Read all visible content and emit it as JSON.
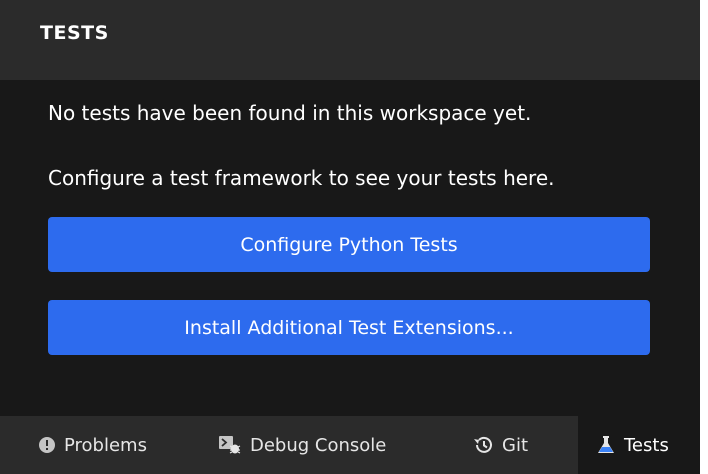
{
  "panel": {
    "title": "TESTS",
    "message_1": "No tests have been found in this workspace yet.",
    "message_2": "Configure a test framework to see your tests here.",
    "configure_button": "Configure Python Tests",
    "install_button": "Install Additional Test Extensions..."
  },
  "tabs": [
    {
      "label": "Problems",
      "icon": "info-circle-icon",
      "active": false
    },
    {
      "label": "Debug Console",
      "icon": "debug-console-icon",
      "active": false
    },
    {
      "label": "Git",
      "icon": "history-icon",
      "active": false
    },
    {
      "label": "Tests",
      "icon": "flask-icon",
      "active": true
    }
  ],
  "colors": {
    "background": "#181818",
    "header": "#2b2b2b",
    "button": "#2d6bee",
    "text": "#ffffff"
  }
}
